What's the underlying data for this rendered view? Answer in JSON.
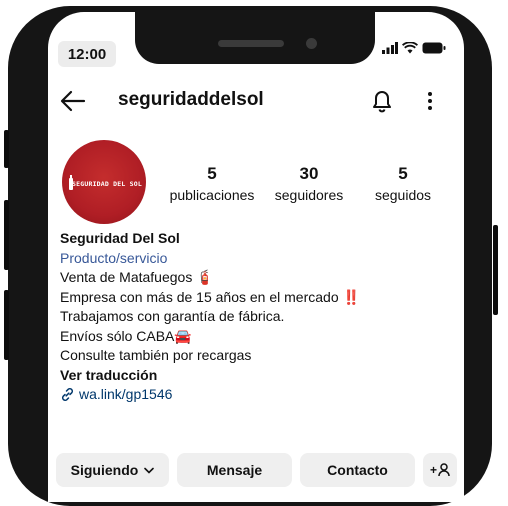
{
  "status_bar": {
    "time": "12:00"
  },
  "header": {
    "username": "seguridaddelsol"
  },
  "profile": {
    "avatar_text": "SEGURIDAD DEL SOL",
    "stats": [
      {
        "value": "5",
        "label": "publicaciones"
      },
      {
        "value": "30",
        "label": "seguidores"
      },
      {
        "value": "5",
        "label": "seguidos"
      }
    ]
  },
  "bio": {
    "name": "Seguridad Del Sol",
    "category": "Producto/servicio",
    "lines": [
      "Venta de Matafuegos 🧯",
      "Empresa con más de 15 años en el mercado ‼️",
      "Trabajamos con garantía de fábrica.",
      "Envíos sólo CABA🚘",
      "Consulte también por recargas"
    ],
    "translate": "Ver traducción",
    "link": "wa.link/gp1546"
  },
  "actions": {
    "following": "Siguiendo",
    "message": "Mensaje",
    "contact": "Contacto",
    "add_user": "+"
  }
}
